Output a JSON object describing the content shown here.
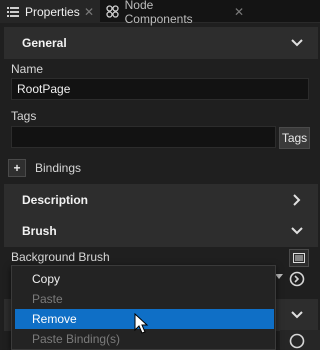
{
  "tabs": [
    {
      "label": "Properties",
      "icon": "list-icon"
    },
    {
      "label": "Node Components",
      "icon": "components-icon"
    }
  ],
  "sections": {
    "general": "General",
    "description": "Description",
    "brush": "Brush"
  },
  "fields": {
    "name_label": "Name",
    "name_value": "RootPage",
    "tags_label": "Tags",
    "tags_value": "",
    "tags_button": "Tags",
    "bindings_label": "Bindings",
    "add_binding": "+",
    "background_brush_label": "Background Brush"
  },
  "context_menu": {
    "items": [
      {
        "label": "Copy",
        "state": "enabled"
      },
      {
        "label": "Paste",
        "state": "disabled"
      },
      {
        "label": "Remove",
        "state": "hover"
      },
      {
        "label": "Paste Binding(s)",
        "state": "disabled"
      }
    ]
  },
  "colors": {
    "background": "#1f1f1f",
    "section": "#2d2d2d",
    "highlight": "#0f6fc6"
  }
}
